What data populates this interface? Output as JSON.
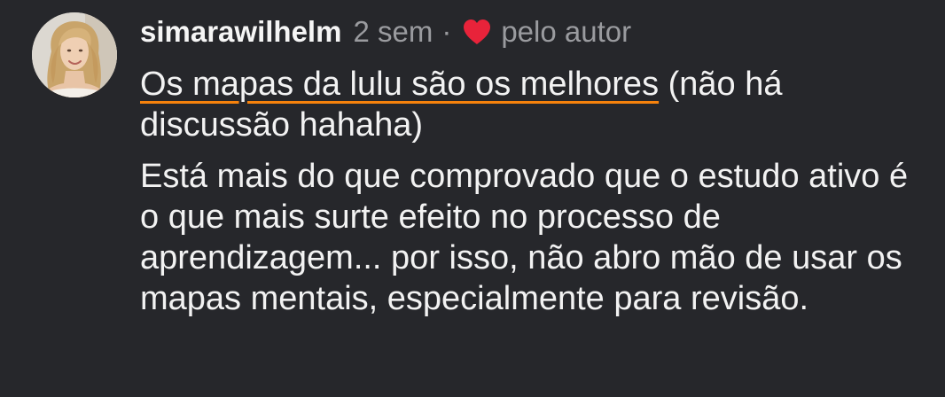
{
  "comment": {
    "username": "simarawilhelm",
    "time": "2 sem",
    "separator": "·",
    "liked_by": "pelo autor",
    "highlighted_text": "Os mapas da lulu são os melhores",
    "first_paragraph_rest": " (não há discussão hahaha)",
    "second_paragraph": "Está mais do que comprovado que o estudo ativo é o que mais surte efeito no processo de aprendizagem... por isso, não abro mão de usar os mapas mentais, especialmente para revisão."
  },
  "icons": {
    "heart": "heart-icon",
    "avatar": "profile-photo"
  },
  "colors": {
    "background": "#26272b",
    "text": "#f2f2f2",
    "muted": "#9a9b9f",
    "heart": "#e8233a",
    "underline": "#f6820c"
  }
}
